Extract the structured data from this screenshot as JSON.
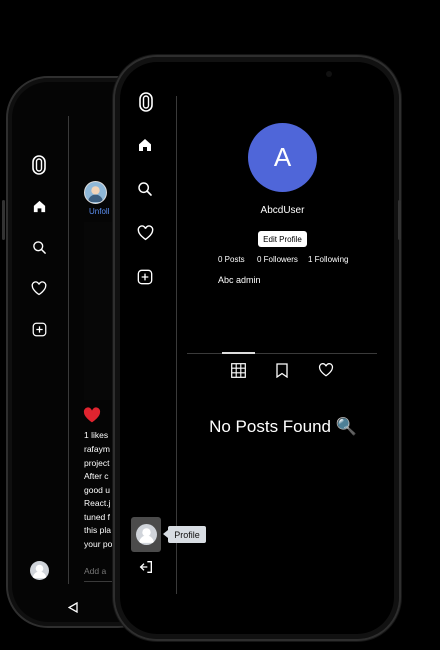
{
  "front": {
    "avatar_letter": "A",
    "username": "AbcdUser",
    "edit_profile_label": "Edit Profile",
    "stats": {
      "posts": "0 Posts",
      "followers": "0 Followers",
      "following": "1 Following"
    },
    "bio": "Abc admin",
    "no_posts": "No Posts Found 🔍",
    "tooltip": "Profile",
    "avatar_color": "#4f66d9"
  },
  "back": {
    "unfollow": "Unfoll",
    "likes": "1 likes",
    "caption_lines": [
      "rafaym",
      "project",
      "After c",
      "good u",
      "React.j",
      "tuned f",
      "this pla",
      "your po"
    ],
    "add_comment": "Add a",
    "heart_color": "#e0242f"
  },
  "sidebar_icons": [
    "logo-icon",
    "home-icon",
    "search-icon",
    "heart-icon",
    "add-post-icon",
    "avatar",
    "logout-icon"
  ]
}
